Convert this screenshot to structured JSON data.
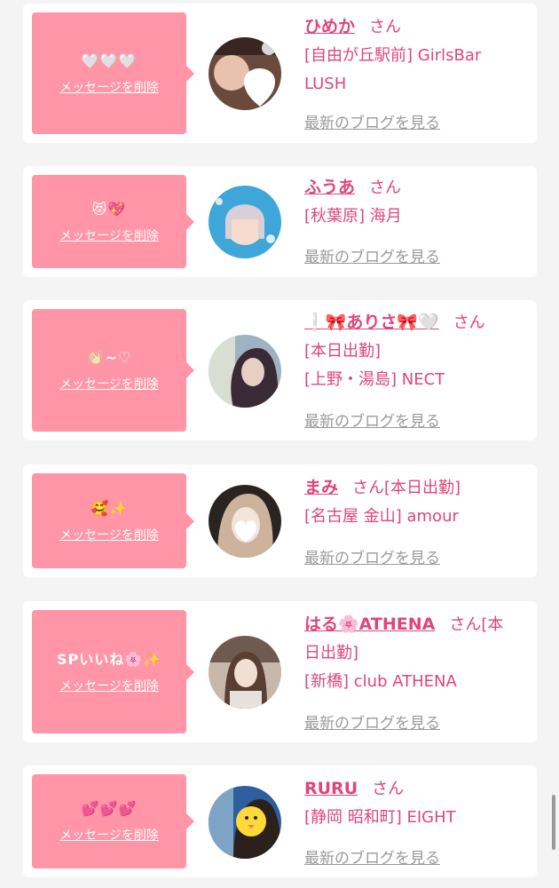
{
  "common": {
    "delete_label": "メッセージを削除",
    "blog_label": "最新のブログを見る",
    "san": "さん"
  },
  "cards": [
    {
      "message": "🤍🤍🤍",
      "name": "ひめか",
      "lines": [
        "[自由が丘駅前] GirlsBar",
        "LUSH"
      ]
    },
    {
      "message": "😻💖",
      "name": "ふうあ",
      "lines": [
        "[秋葉原] 海月"
      ]
    },
    {
      "message": "👏🏻~♡",
      "name": "❕🎀ありさ🎀🤍",
      "lines": [
        "[本日出勤]",
        "[上野・湯島] NECT"
      ]
    },
    {
      "message": "🥰✨",
      "name": "まみ",
      "san_suffix": "[本日出勤]",
      "lines": [
        "[名古屋 金山] amour"
      ]
    },
    {
      "message": "SPいいね🌸✨",
      "name": "はる🌸ATHENA",
      "san_suffix": "[本",
      "lines": [
        "日出勤]",
        "[新橋] club ATHENA"
      ]
    },
    {
      "message": "💕💕💕",
      "name": "RURU",
      "lines": [
        "[静岡 昭和町] EIGHT"
      ]
    }
  ],
  "colors": {
    "accent": "#e0457a",
    "message_box": "#ff95a6",
    "link_gray": "#9a9a9a"
  }
}
